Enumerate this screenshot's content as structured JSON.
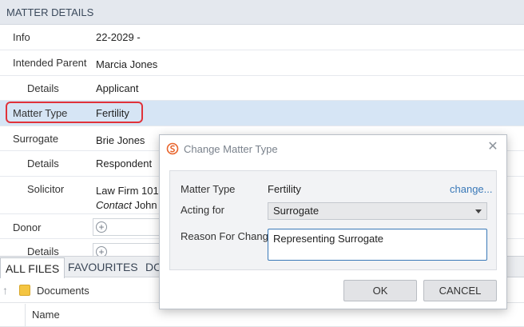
{
  "details": {
    "header": "MATTER DETAILS",
    "rows": [
      {
        "label": "Info",
        "value": "22-2029 -"
      },
      {
        "label": "Intended Parent",
        "value": "Marcia Jones"
      },
      {
        "label": "Details",
        "value": "Applicant"
      },
      {
        "label": "Matter Type",
        "value": "Fertility"
      },
      {
        "label": "Surrogate",
        "value": "Brie Jones"
      },
      {
        "label": "Details",
        "value": "Respondent"
      },
      {
        "label": "Solicitor",
        "value": "Law Firm 101"
      },
      {
        "label": "Donor",
        "value": ""
      },
      {
        "label": "Details",
        "value": ""
      }
    ],
    "contact_label": "Contact",
    "contact_value": "John"
  },
  "tabs": {
    "all_files": "ALL FILES",
    "favourites": "FAVOURITES",
    "third": "DO"
  },
  "files": {
    "path": "Documents",
    "column_name": "Name"
  },
  "dialog": {
    "title": "Change Matter Type",
    "matter_type_label": "Matter Type",
    "matter_type_value": "Fertility",
    "change_link": "change...",
    "acting_for_label": "Acting for",
    "acting_for_value": "Surrogate",
    "reason_label": "Reason For Change",
    "reason_value": "Representing Surrogate",
    "ok_label": "OK",
    "cancel_label": "CANCEL"
  },
  "colors": {
    "selected_row": "#d6e5f5",
    "highlight": "#e0323a",
    "link": "#3a79b8",
    "logo": "#e8642c"
  }
}
